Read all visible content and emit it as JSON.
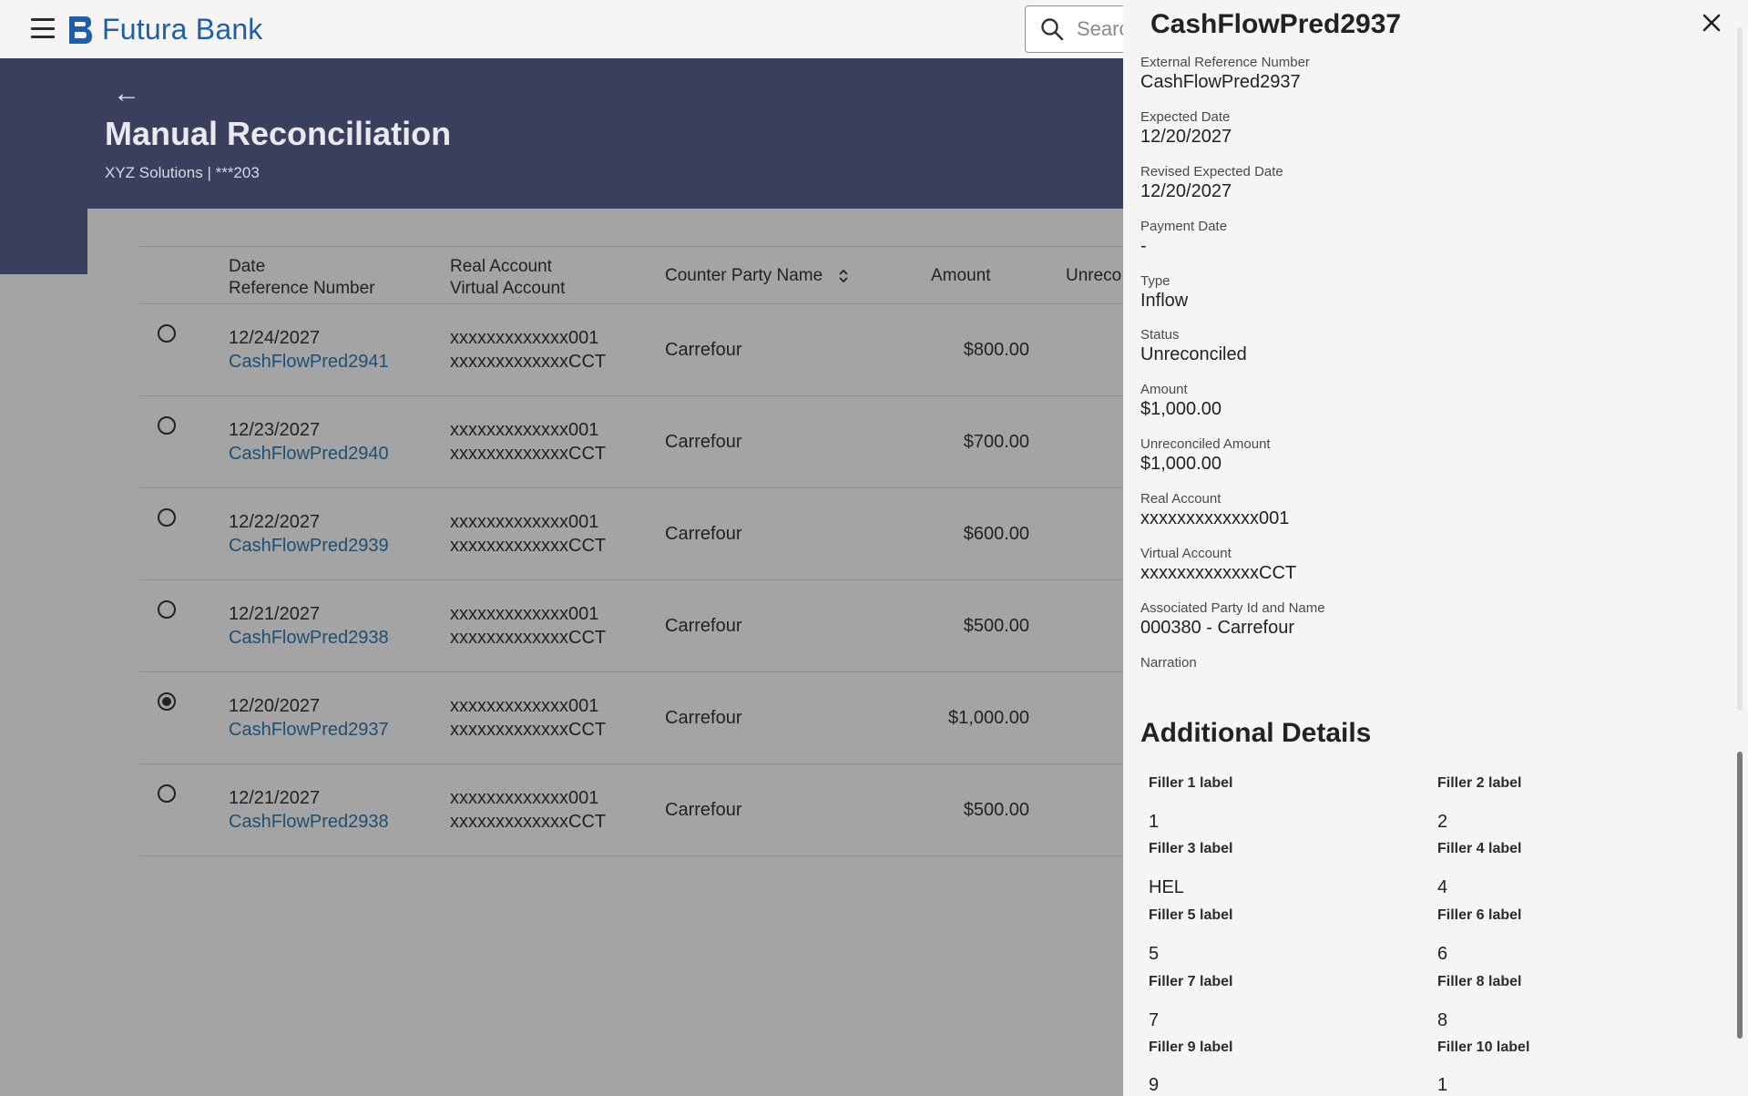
{
  "header": {
    "brand": "Futura Bank",
    "search_placeholder": "Search"
  },
  "page": {
    "title": "Manual Reconciliation",
    "subtitle": "XYZ Solutions | ***203"
  },
  "table": {
    "headers": {
      "date": "Date",
      "reference": "Reference Number",
      "real_account": "Real Account",
      "virtual_account": "Virtual Account",
      "counter_party": "Counter Party Name",
      "amount": "Amount",
      "unreconciled": "Unreco"
    },
    "rows": [
      {
        "date": "12/24/2027",
        "ref": "CashFlowPred2941",
        "real": "xxxxxxxxxxxxx001",
        "virtual": "xxxxxxxxxxxxxCCT",
        "party": "Carrefour",
        "amount": "$800.00",
        "selected": false
      },
      {
        "date": "12/23/2027",
        "ref": "CashFlowPred2940",
        "real": "xxxxxxxxxxxxx001",
        "virtual": "xxxxxxxxxxxxxCCT",
        "party": "Carrefour",
        "amount": "$700.00",
        "selected": false
      },
      {
        "date": "12/22/2027",
        "ref": "CashFlowPred2939",
        "real": "xxxxxxxxxxxxx001",
        "virtual": "xxxxxxxxxxxxxCCT",
        "party": "Carrefour",
        "amount": "$600.00",
        "selected": false
      },
      {
        "date": "12/21/2027",
        "ref": "CashFlowPred2938",
        "real": "xxxxxxxxxxxxx001",
        "virtual": "xxxxxxxxxxxxxCCT",
        "party": "Carrefour",
        "amount": "$500.00",
        "selected": false
      },
      {
        "date": "12/20/2027",
        "ref": "CashFlowPred2937",
        "real": "xxxxxxxxxxxxx001",
        "virtual": "xxxxxxxxxxxxxCCT",
        "party": "Carrefour",
        "amount": "$1,000.00",
        "selected": true
      },
      {
        "date": "12/21/2027",
        "ref": "CashFlowPred2938",
        "real": "xxxxxxxxxxxxx001",
        "virtual": "xxxxxxxxxxxxxCCT",
        "party": "Carrefour",
        "amount": "$500.00",
        "selected": false
      }
    ]
  },
  "drawer": {
    "title": "CashFlowPred2937",
    "fields": [
      {
        "label": "External Reference Number",
        "value": "CashFlowPred2937"
      },
      {
        "label": "Expected Date",
        "value": "12/20/2027"
      },
      {
        "label": "Revised Expected Date",
        "value": "12/20/2027"
      },
      {
        "label": "Payment Date",
        "value": "-"
      },
      {
        "label": "Type",
        "value": "Inflow"
      },
      {
        "label": "Status",
        "value": "Unreconciled"
      },
      {
        "label": "Amount",
        "value": "$1,000.00"
      },
      {
        "label": "Unreconciled Amount",
        "value": "$1,000.00"
      },
      {
        "label": "Real Account",
        "value": "xxxxxxxxxxxxx001"
      },
      {
        "label": "Virtual Account",
        "value": "xxxxxxxxxxxxxCCT"
      },
      {
        "label": "Associated Party Id and Name",
        "value": "000380 - Carrefour"
      },
      {
        "label": "Narration",
        "value": ""
      }
    ],
    "additional_title": "Additional Details",
    "additional": [
      {
        "label": "Filler 1 label",
        "value": "1"
      },
      {
        "label": "Filler 2 label",
        "value": "2"
      },
      {
        "label": "Filler 3 label",
        "value": "HEL"
      },
      {
        "label": "Filler 4 label",
        "value": "4"
      },
      {
        "label": "Filler 5 label",
        "value": "5"
      },
      {
        "label": "Filler 6 label",
        "value": "6"
      },
      {
        "label": "Filler 7 label",
        "value": "7"
      },
      {
        "label": "Filler 8 label",
        "value": "8"
      },
      {
        "label": "Filler 9 label",
        "value": "9"
      },
      {
        "label": "Filler 10 label",
        "value": "1"
      }
    ]
  }
}
